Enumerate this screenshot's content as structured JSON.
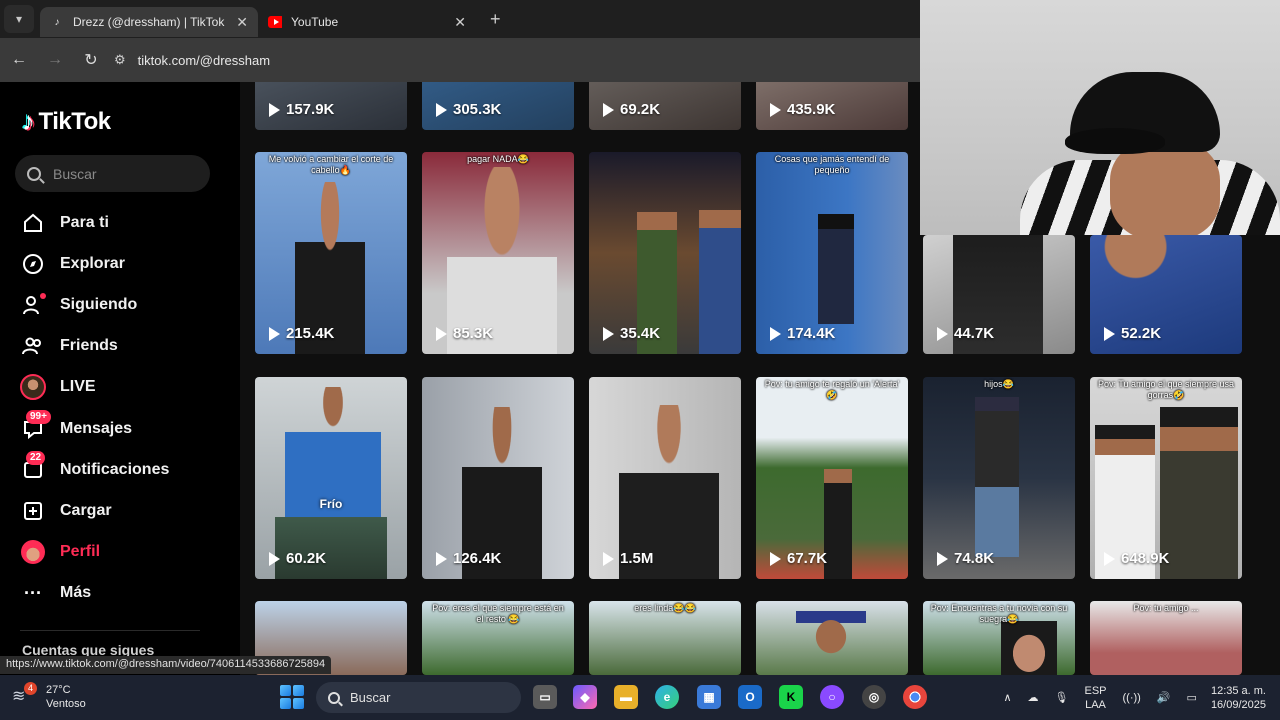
{
  "browser": {
    "tabs": [
      {
        "title": "Drezz (@dressham) | TikTok",
        "active": true
      },
      {
        "title": "YouTube",
        "active": false
      }
    ],
    "url": "tiktok.com/@dressham",
    "status_link": "https://www.tiktok.com/@dressham/video/7406114533686725894"
  },
  "tiktok": {
    "logo": "TikTok",
    "search_placeholder": "Buscar",
    "nav": [
      {
        "label": "Para ti",
        "icon": "home-icon"
      },
      {
        "label": "Explorar",
        "icon": "compass-icon"
      },
      {
        "label": "Siguiendo",
        "icon": "following-icon"
      },
      {
        "label": "Friends",
        "icon": "friends-icon"
      },
      {
        "label": "LIVE",
        "icon": "live-avatar"
      },
      {
        "label": "Mensajes",
        "icon": "messages-icon",
        "badge": "99+"
      },
      {
        "label": "Notificaciones",
        "icon": "notifications-icon",
        "badge": "22"
      },
      {
        "label": "Cargar",
        "icon": "upload-icon"
      },
      {
        "label": "Perfil",
        "icon": "profile-avatar"
      },
      {
        "label": "Más",
        "icon": "more-icon"
      }
    ],
    "following_heading": "Cuentas que sigues"
  },
  "videos": {
    "row0": [
      "157.9K",
      "305.3K",
      "69.2K",
      "435.9K"
    ],
    "row1": [
      "215.4K",
      "85.3K",
      "35.4K",
      "174.4K",
      "44.7K",
      "52.2K"
    ],
    "row2": [
      "60.2K",
      "126.4K",
      "1.5M",
      "67.7K",
      "74.8K",
      "648.9K"
    ],
    "captions1": [
      "Me volvió a cambiar el corte de cabello🔥",
      "pagar NADA😂",
      "",
      "Cosas que jamás entendí de pequeño",
      "",
      ""
    ],
    "captions2": [
      "",
      "",
      "",
      "Pov: tu amigo te regaló un 'Alerta' 🤣",
      "hijos😂",
      "Pov: Tu amigo el que siempre usa gorras🤣"
    ],
    "overlay_text": "Frío",
    "captions3": [
      "",
      "Pov: eres el que siempre está en el resto 😂",
      "eres linda😂😂",
      "",
      "Pov: Encuentras a tu novia con su suegra😂",
      "Pov: tu amigo ..."
    ]
  },
  "taskbar": {
    "weather_temp": "27°C",
    "weather_desc": "Ventoso",
    "weather_badge": "4",
    "search_label": "Buscar",
    "lang_top": "ESP",
    "lang_bottom": "LAA",
    "time": "12:35 a. m.",
    "date": "16/09/2025"
  },
  "colors": {
    "accent": "#fe2c55",
    "sidebar_bg": "#000000",
    "chrome_bg": "#1f1f1f"
  }
}
